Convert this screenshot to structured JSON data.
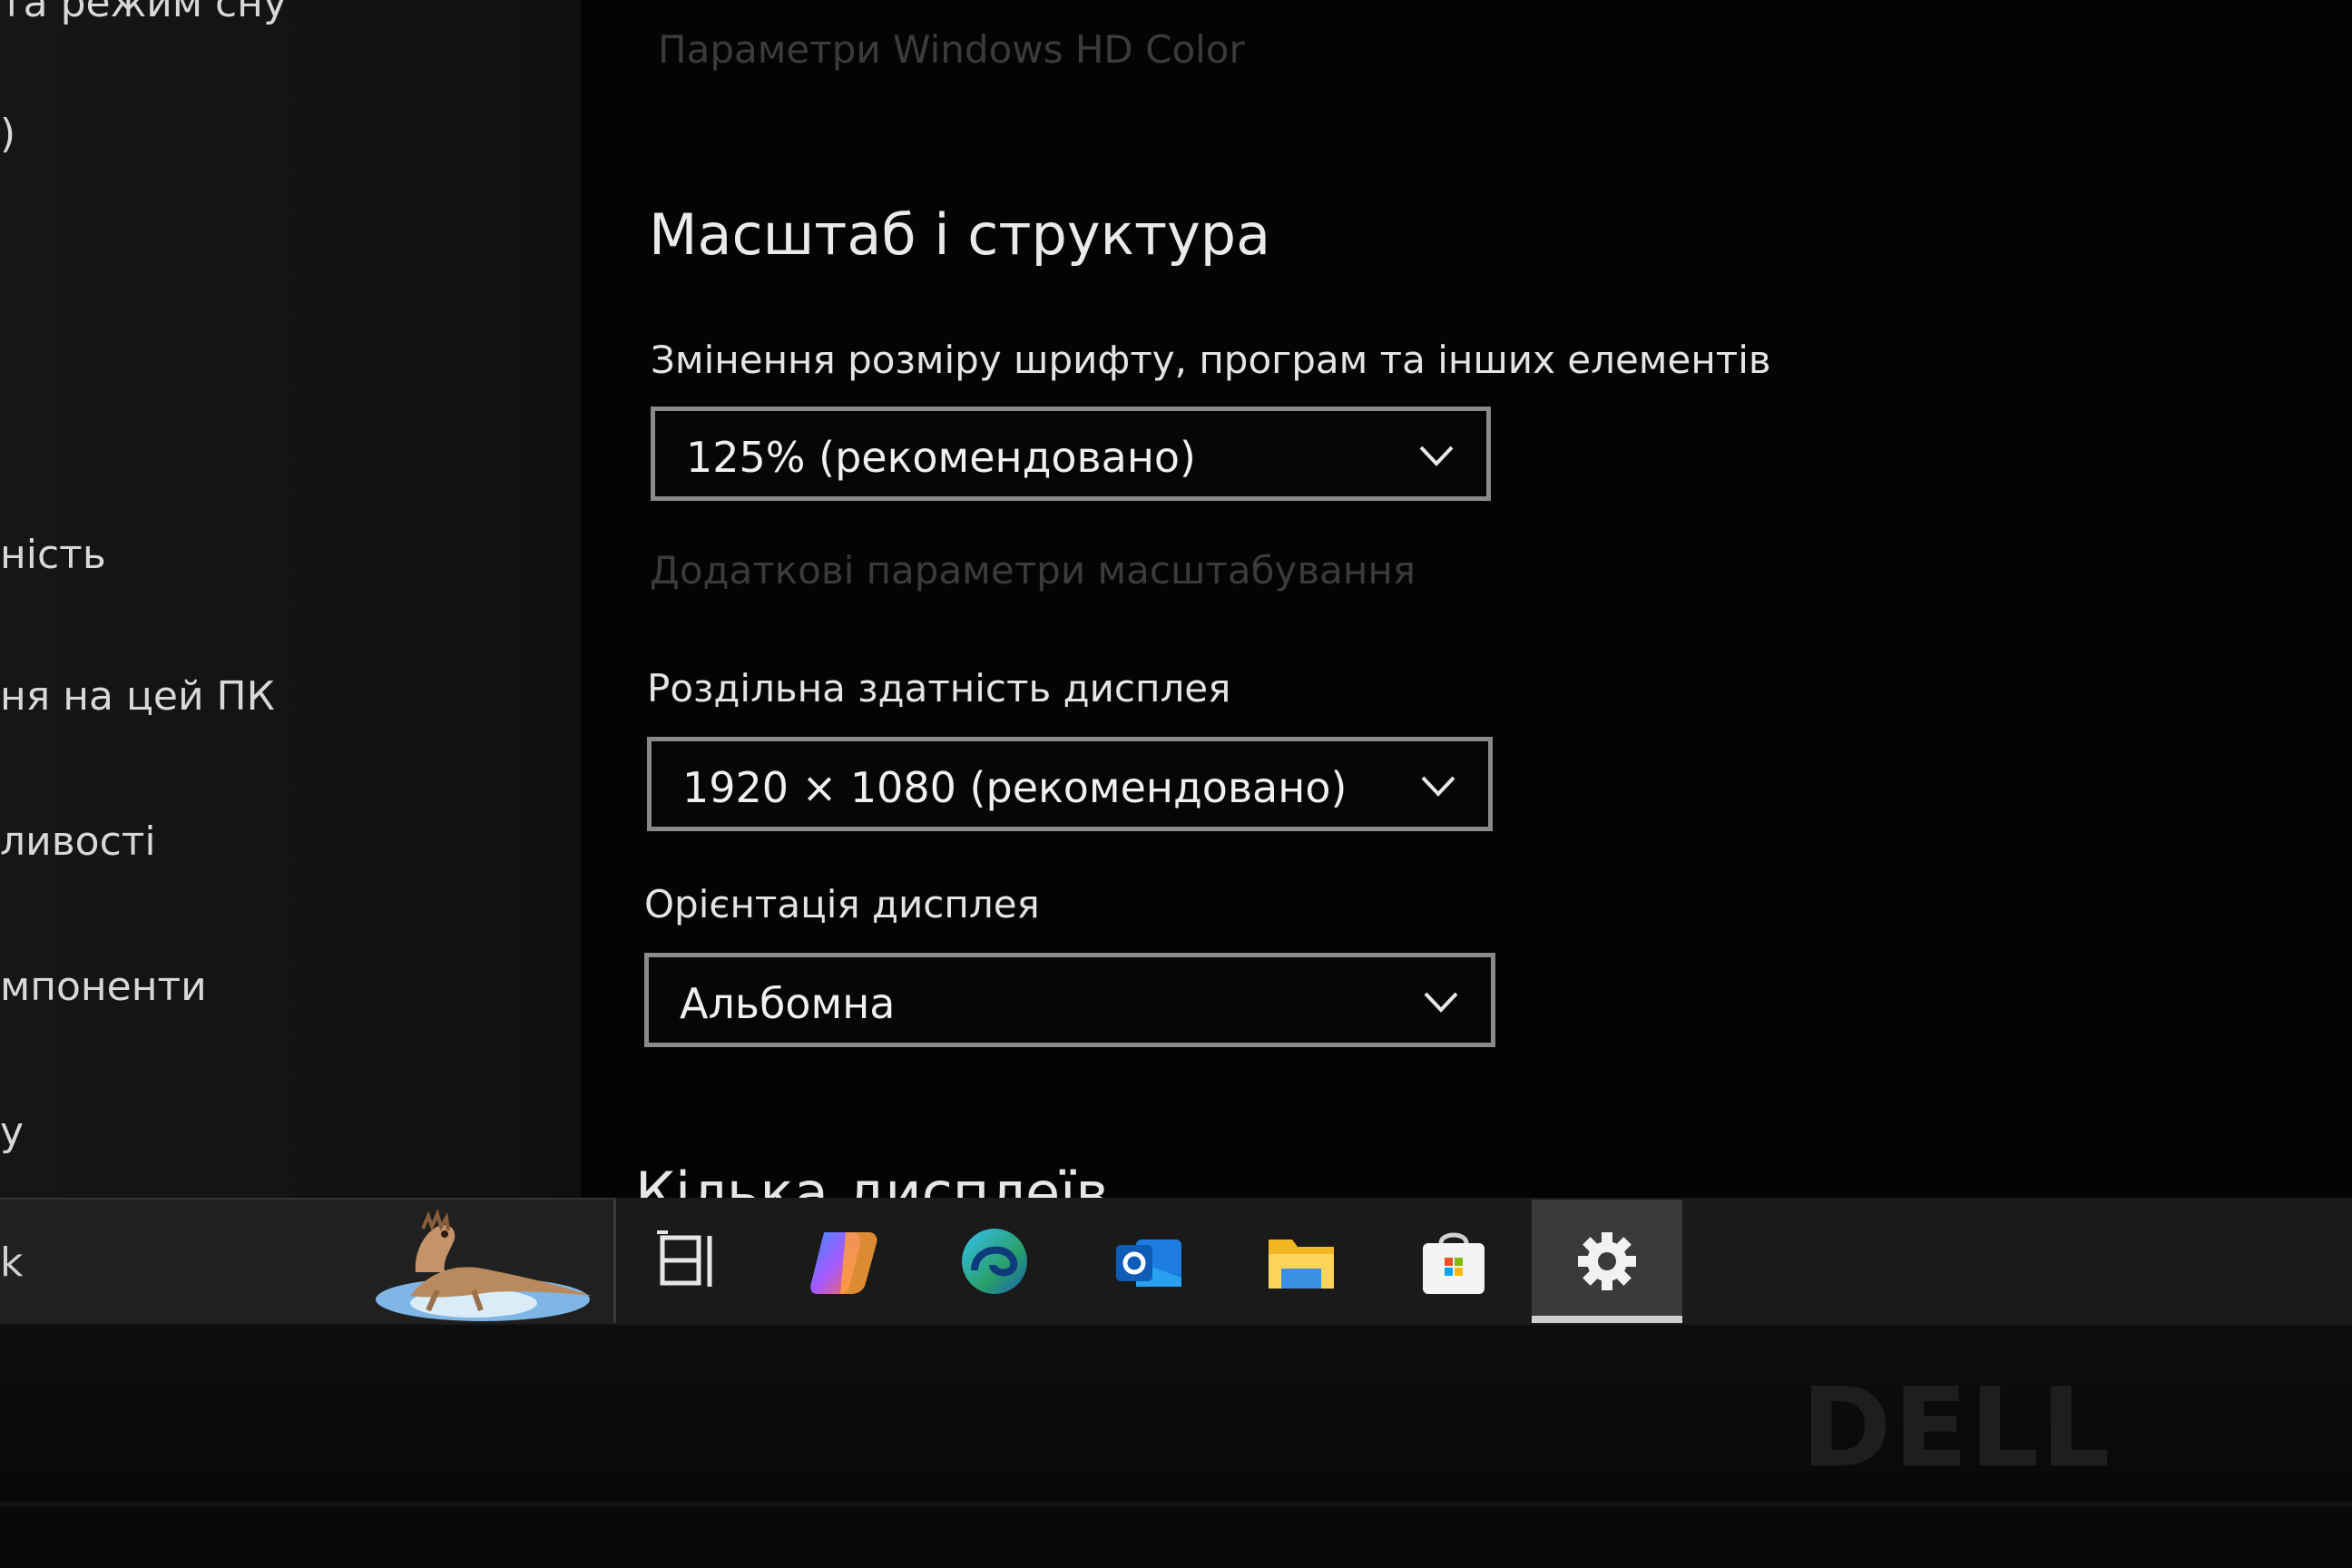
{
  "sidebar": {
    "items": [
      {
        "label": "та режим сну"
      },
      {
        "label": ")"
      },
      {
        "label": "ність"
      },
      {
        "label": "ня на цей ПК"
      },
      {
        "label": "ливості"
      },
      {
        "label": "мпоненти"
      },
      {
        "label": "у"
      }
    ]
  },
  "main": {
    "hd_color_link": "Параметри Windows HD Color",
    "section_title": "Масштаб і структура",
    "scale": {
      "label": "Змінення розміру шрифту, програм та інших елементів",
      "value": "125% (рекомендовано)"
    },
    "advanced_scaling_link": "Додаткові параметри масштабування",
    "resolution": {
      "label": "Роздільна здатність дисплея",
      "value": "1920 × 1080 (рекомендовано)"
    },
    "orientation": {
      "label": "Орієнтація дисплея",
      "value": "Альбомна"
    },
    "multiple_displays_title": "Кілька дисплеїв"
  },
  "taskbar": {
    "search_partial": "k",
    "icons": [
      "task-view-icon",
      "copilot-icon",
      "edge-icon",
      "outlook-icon",
      "file-explorer-icon",
      "microsoft-store-icon",
      "settings-icon"
    ],
    "active_app": "settings-icon"
  },
  "bezel": {
    "brand": "DELL"
  },
  "colors": {
    "background": "#040404",
    "sidebar": "#141414",
    "text": "#e4e4e4",
    "dim_text": "#3b3b3b",
    "dropdown_border": "#8a8a8a",
    "taskbar": "#1a1a1a",
    "taskbar_active": "#3a3a3a"
  }
}
